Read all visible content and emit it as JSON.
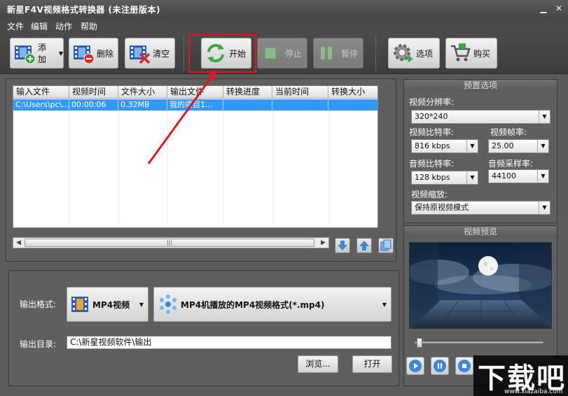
{
  "window": {
    "title": "新星F4V视频格式转换器  (未注册版本)"
  },
  "menu": {
    "items": [
      "文件",
      "编辑",
      "动作",
      "帮助"
    ]
  },
  "toolbar": {
    "add_label": "添加",
    "delete_label": "删除",
    "clear_label": "清空",
    "start_label": "开始",
    "stop_label": "停止",
    "pause_label": "暂停",
    "options_label": "选项",
    "buy_label": "购买"
  },
  "file_table": {
    "columns": [
      "输入文件",
      "视频时间",
      "文件大小",
      "输出文件",
      "转换进度",
      "当前时间",
      "转换大小"
    ],
    "rows": [
      {
        "input": "C:\\Users\\pc\\...",
        "duration": "00:00:06",
        "size": "0.32MB",
        "output": "我的项目1...",
        "progress": "",
        "current": "",
        "converted": ""
      }
    ]
  },
  "output": {
    "format_label": "输出格式:",
    "format_category": "MP4视频",
    "format_detail": "MP4机播放的MP4视频格式(*.mp4)",
    "dir_label": "输出目录:",
    "dir_value": "C:\\新星视频软件\\输出",
    "browse_label": "浏览...",
    "open_label": "打开"
  },
  "preset": {
    "title": "预置选项",
    "resolution_label": "视频分辨率:",
    "resolution_value": "320*240",
    "vbitrate_label": "视频比特率:",
    "vbitrate_value": "816 kbps",
    "framerate_label": "视频帧率:",
    "framerate_value": "25.00",
    "abitrate_label": "音频比特率:",
    "abitrate_value": "128 kbps",
    "samplerate_label": "音频采样率:",
    "samplerate_value": "44100",
    "scale_label": "视频缩放:",
    "scale_value": "保持原视频模式"
  },
  "preview": {
    "title": "视频预览",
    "position": 0.02
  },
  "watermark": {
    "text": "下载吧",
    "url": "www.xiazaiba.com"
  },
  "colors": {
    "highlight": "#e0171b",
    "selection": "#3399ff",
    "arrow": "#d9191c"
  }
}
